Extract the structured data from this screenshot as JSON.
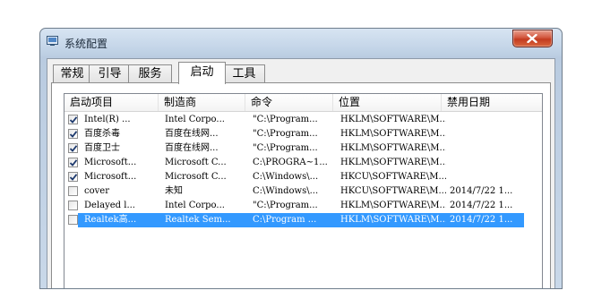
{
  "window": {
    "title": "系统配置",
    "close_glyph": "×"
  },
  "tabs": [
    {
      "label": "常规",
      "active": false
    },
    {
      "label": "引导",
      "active": false
    },
    {
      "label": "服务",
      "active": false
    },
    {
      "label": "启动",
      "active": true
    },
    {
      "label": "工具",
      "active": false
    }
  ],
  "columns": [
    "启动项目",
    "制造商",
    "命令",
    "位置",
    "禁用日期"
  ],
  "rows": [
    {
      "checked": true,
      "selected": false,
      "item": "Intel(R) ...",
      "maker": "Intel Corpo...",
      "command": "\"C:\\Program...",
      "location": "HKLM\\SOFTWARE\\M...",
      "disabled": ""
    },
    {
      "checked": true,
      "selected": false,
      "item": "百度杀毒",
      "maker": "百度在线网...",
      "command": "\"C:\\Program...",
      "location": "HKLM\\SOFTWARE\\M...",
      "disabled": ""
    },
    {
      "checked": true,
      "selected": false,
      "item": "百度卫士",
      "maker": "百度在线网...",
      "command": "\"C:\\Program...",
      "location": "HKLM\\SOFTWARE\\M...",
      "disabled": ""
    },
    {
      "checked": true,
      "selected": false,
      "item": "Microsoft...",
      "maker": "Microsoft C...",
      "command": "C:\\PROGRA~1...",
      "location": "HKLM\\SOFTWARE\\M...",
      "disabled": ""
    },
    {
      "checked": true,
      "selected": false,
      "item": "Microsoft...",
      "maker": "Microsoft C...",
      "command": "C:\\Windows\\...",
      "location": "HKCU\\SOFTWARE\\M...",
      "disabled": ""
    },
    {
      "checked": false,
      "selected": false,
      "item": "cover",
      "maker": "未知",
      "command": "C:\\Windows\\...",
      "location": "HKCU\\SOFTWARE\\M...",
      "disabled": "2014/7/22 1..."
    },
    {
      "checked": false,
      "selected": false,
      "item": "Delayed l...",
      "maker": "Intel Corpo...",
      "command": "\"C:\\Program...",
      "location": "HKLM\\SOFTWARE\\M...",
      "disabled": "2014/7/22 1..."
    },
    {
      "checked": false,
      "selected": true,
      "item": "Realtek高...",
      "maker": "Realtek Sem...",
      "command": "C:\\Program ...",
      "location": "HKLM\\SOFTWARE\\M...",
      "disabled": "2014/7/22 1..."
    }
  ],
  "colors": {
    "selection": "#3399ff",
    "close_button": "#c94a2f",
    "checkmark": "#1e3a6e"
  }
}
